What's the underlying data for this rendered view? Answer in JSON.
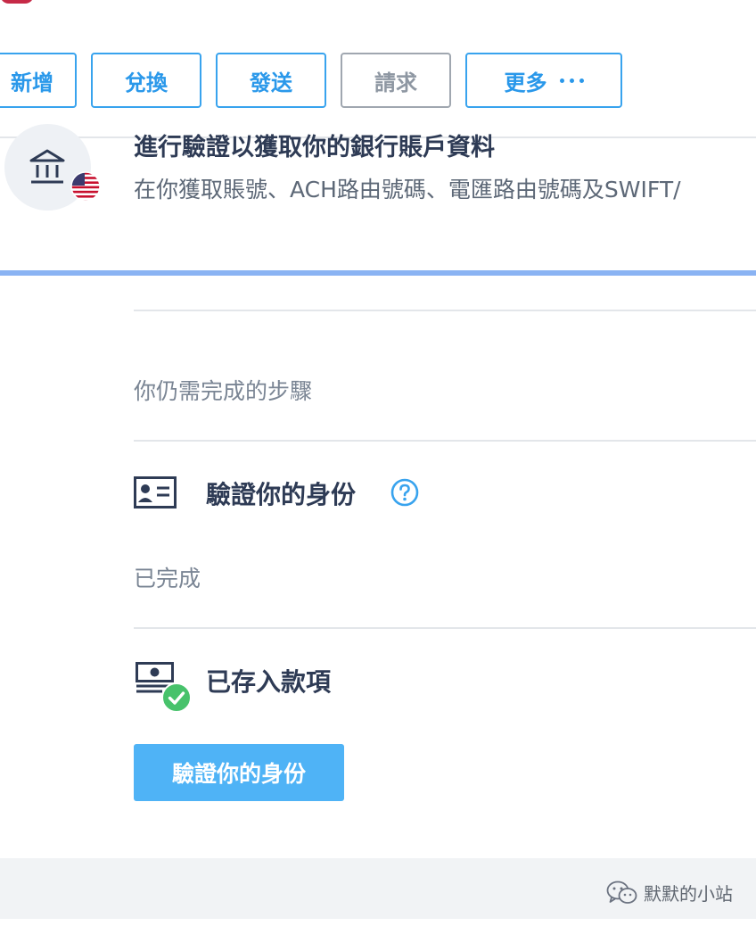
{
  "actions": {
    "add": "新增",
    "exchange": "兌換",
    "send": "發送",
    "request": "請求",
    "more": "更多"
  },
  "banner": {
    "title": "進行驗證以獲取你的銀行賬戶資料",
    "description": "在你獲取賬號、ACH路由號碼、電匯路由號碼及SWIFT/"
  },
  "steps": {
    "remaining_label": "你仍需完成的步驟",
    "verify_identity": "驗證你的身份",
    "completed_label": "已完成",
    "deposit": "已存入款項",
    "cta": "驗證你的身份"
  },
  "footer": {
    "watermark": "默默的小站"
  },
  "colors": {
    "accent": "#2a98ea",
    "cta": "#4fb3f6",
    "progress": "#8ab3f3",
    "success": "#47c26b"
  },
  "icons": {
    "bank": "bank-icon",
    "flag": "us-flag-icon",
    "id_card": "id-card-icon",
    "help": "help-icon",
    "money": "money-icon",
    "check": "check-icon",
    "more": "more-dots-icon"
  }
}
